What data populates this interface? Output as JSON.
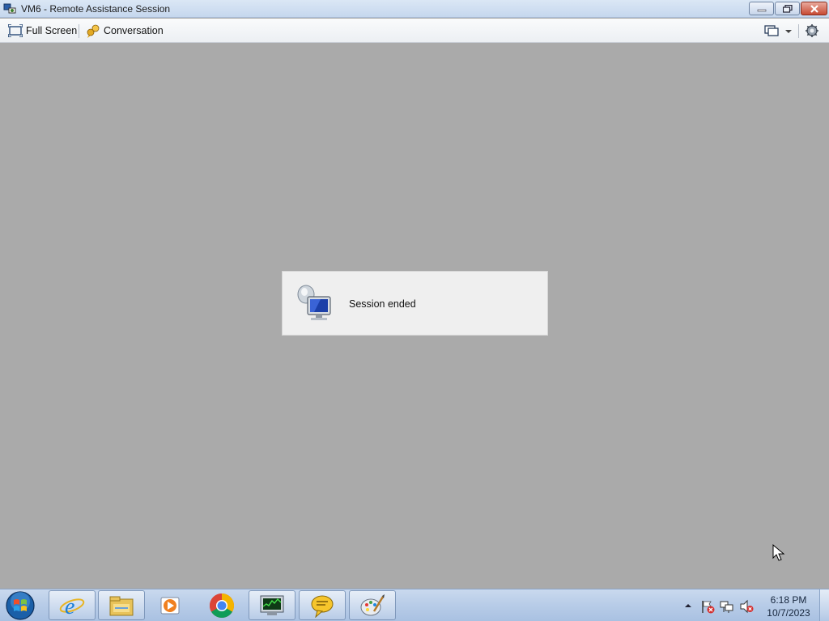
{
  "window": {
    "title": "VM6 - Remote Assistance Session",
    "app_icon": "remote-assistance-icon"
  },
  "toolbar": {
    "full_screen_label": "Full Screen",
    "conversation_label": "Conversation",
    "right_icons": [
      "display-settings-icon",
      "dropdown-arrow-icon",
      "settings-icon"
    ]
  },
  "session": {
    "message": "Session ended",
    "icon": "remote-assistance-icon"
  },
  "taskbar": {
    "pinned": [
      "start-orb",
      "internet-explorer-icon",
      "file-explorer-icon",
      "media-player-icon",
      "chrome-icon",
      "resource-monitor-icon",
      "speech-bubble-icon",
      "paint-icon"
    ],
    "tray_icons": [
      "show-hidden-icons-arrow",
      "action-center-flag-icon",
      "network-icon",
      "volume-muted-icon"
    ],
    "time": "6:18 PM",
    "date": "10/7/2023"
  },
  "colors": {
    "client_background": "#aaaaaa",
    "panel_background": "#efefef",
    "close_button": "#c74a33",
    "taskbar": "#b9cde8"
  }
}
